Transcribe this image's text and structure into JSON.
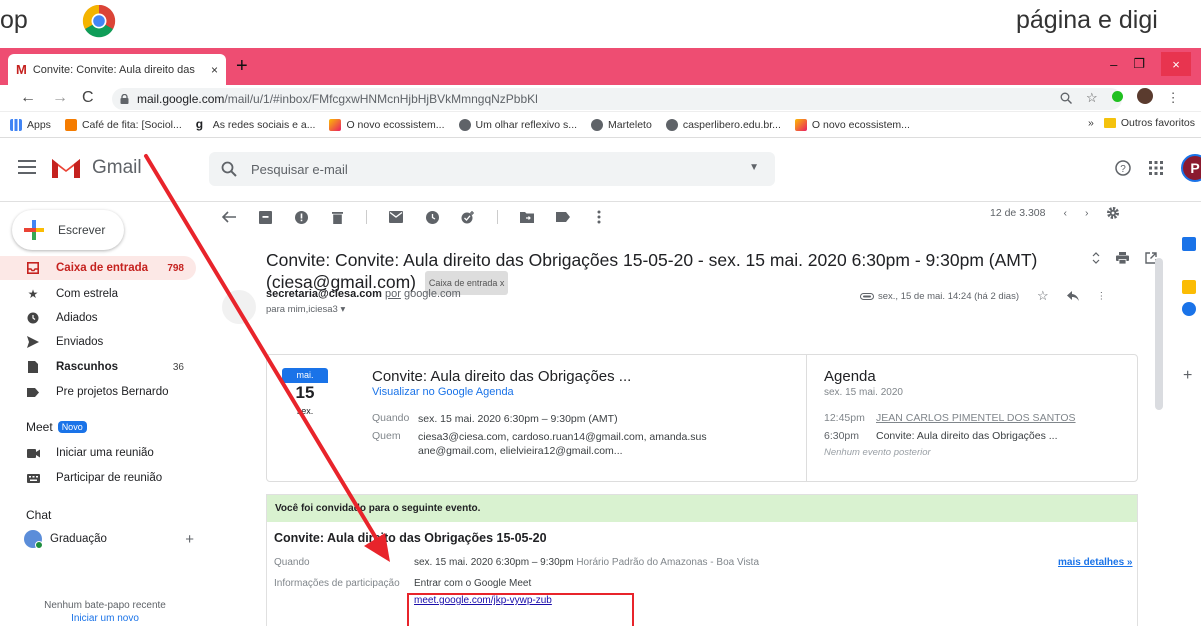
{
  "top": {
    "left_text": "op",
    "right_text": "página e digi"
  },
  "browser": {
    "tab_title": "Convite: Convite: Aula direito das",
    "tab_favicon": "M",
    "new_tab": "+",
    "url_host": "mail.google.com",
    "url_path": "/mail/u/1/#inbox/FMfcgxwHNMcnHjbHjBVkMmngqNzPbbKl",
    "win_min": "–",
    "win_max": "❐",
    "win_close": "×"
  },
  "bookmarks": {
    "items": [
      {
        "label": "Apps",
        "color": "#4285f4"
      },
      {
        "label": "Café de fita: [Sociol...",
        "color": "#f57c00"
      },
      {
        "label": "As redes sociais e a...",
        "color": "#202124"
      },
      {
        "label": "O novo ecossistem...",
        "color": "#fbbc04"
      },
      {
        "label": "Um olhar reflexivo s...",
        "color": "#5f6368"
      },
      {
        "label": "Marteleto",
        "color": "#5f6368"
      },
      {
        "label": "casperlibero.edu.br...",
        "color": "#5f6368"
      },
      {
        "label": "O novo ecossistem...",
        "color": "#fbbc04"
      }
    ],
    "more": "»",
    "other": "Outros favoritos"
  },
  "gmail": {
    "brand": "Gmail",
    "search_placeholder": "Pesquisar e-mail",
    "avatar_letter": "P",
    "compose": "Escrever",
    "nav": [
      {
        "label": "Caixa de entrada",
        "count": "798",
        "icon": "inbox-icon"
      },
      {
        "label": "Com estrela",
        "count": "",
        "icon": "star-icon"
      },
      {
        "label": "Adiados",
        "count": "",
        "icon": "clock-icon"
      },
      {
        "label": "Enviados",
        "count": "",
        "icon": "send-icon"
      },
      {
        "label": "Rascunhos",
        "count": "36",
        "icon": "draft-icon"
      },
      {
        "label": "Pre projetos Bernardo",
        "count": "",
        "icon": "label-icon"
      }
    ],
    "meet": {
      "title": "Meet",
      "badge": "Novo",
      "items": [
        {
          "label": "Iniciar uma reunião",
          "icon": "video-icon"
        },
        {
          "label": "Participar de reunião",
          "icon": "keyboard-icon"
        }
      ]
    },
    "chat": {
      "title": "Chat",
      "user": "Graduação",
      "none": "Nenhum bate-papo recente",
      "start": "Iniciar um novo"
    },
    "pager": {
      "text": "12 de 3.308",
      "prev": "‹",
      "next": "›"
    }
  },
  "email": {
    "subject": "Convite: Convite: Aula direito das Obrigações 15-05-20 - sex. 15 mai. 2020 6:30pm - 9:30pm (AMT) (ciesa@gmail.com)",
    "label_chip": "Caixa de entrada x",
    "sender": "secretaria@ciesa.com",
    "via": "por",
    "via_domain": "google.com",
    "to": "para mim,iciesa3 ▾",
    "date": "sex., 15 de mai. 14:24 (há 2 dias)"
  },
  "invite_card": {
    "month": "mai.",
    "day": "15",
    "dow": "sex.",
    "title": "Convite: Aula direito das Obrigações ...",
    "link": "Visualizar no Google Agenda",
    "when_label": "Quando",
    "when_value": "sex. 15 mai. 2020 6:30pm – 9:30pm (AMT)",
    "who_label": "Quem",
    "who_value": "ciesa3@ciesa.com, cardoso.ruan14@gmail.com, amanda.sus ane@gmail.com, elielvieira12@gmail.com...",
    "agenda_title": "Agenda",
    "agenda_date": "sex. 15 mai. 2020",
    "agenda_r1_time": "12:45pm",
    "agenda_r1_event": "JEAN CARLOS PIMENTEL DOS SANTOS",
    "agenda_r2_time": "6:30pm",
    "agenda_r2_event": "Convite: Aula direito das Obrigações ...",
    "agenda_none": "Nenhum evento posterior"
  },
  "invitation": {
    "banner": "Você foi convidado para o seguinte evento.",
    "title": "Convite: Aula direito das Obrigações 15-05-20",
    "when_label": "Quando",
    "when_value": "sex. 15 mai. 2020 6:30pm – 9:30pm",
    "when_tz": "Horário Padrão do Amazonas - Boa Vista",
    "more": "mais detalhes »",
    "join_label": "Informações de participação",
    "join_value": "Entrar com o Google Meet",
    "meet_link": "meet.google.com/jkp-vywp-zub"
  },
  "colors": {
    "tabbar": "#ee4d72",
    "annotation": "#e8242b",
    "gmail_red": "#c5221f"
  }
}
